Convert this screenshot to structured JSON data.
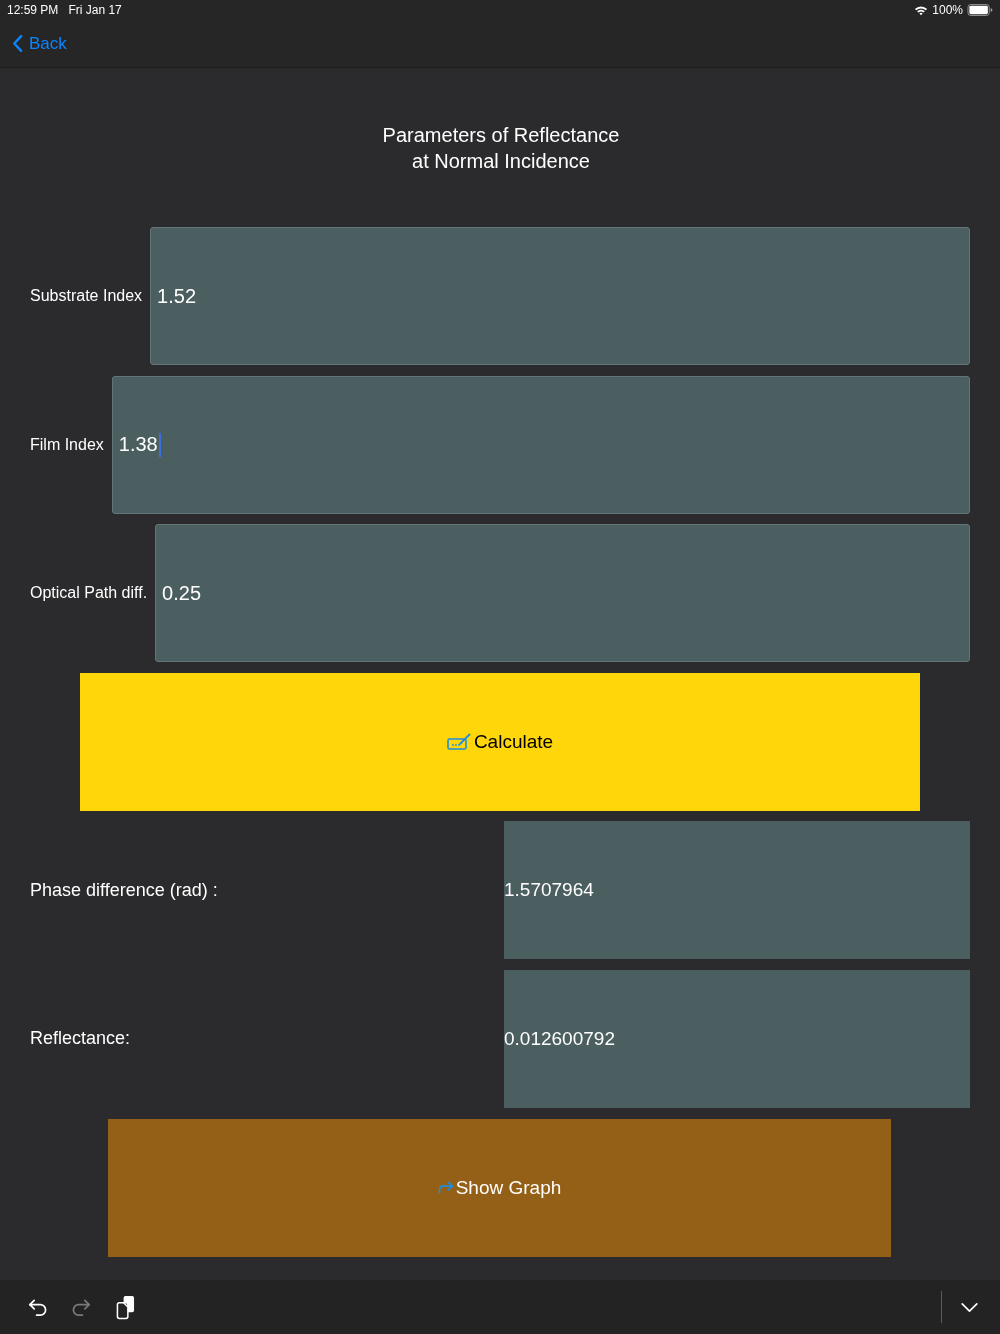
{
  "status_bar": {
    "time": "12:59 PM",
    "date": "Fri Jan 17",
    "battery": "100%"
  },
  "nav": {
    "back": "Back"
  },
  "title": "Parameters of Reflectance\nat Normal Incidence",
  "inputs": [
    {
      "label": "Substrate Index",
      "value": "1.52",
      "focused": false
    },
    {
      "label": "Film Index",
      "value": "1.38",
      "focused": true
    },
    {
      "label": "Optical Path diff.",
      "value": "0.25",
      "focused": false
    }
  ],
  "calculate_button": {
    "label": "Calculate"
  },
  "results": [
    {
      "label": "Phase difference (rad) :",
      "value": "1.5707964"
    },
    {
      "label": "Reflectance:",
      "value": "0.012600792"
    }
  ],
  "graph_button": {
    "label": "Show Graph"
  },
  "keyboard_bar": {
    "items": [
      {
        "kind": "undo",
        "disabled": false
      },
      {
        "kind": "redo",
        "disabled": true
      },
      {
        "kind": "paste",
        "disabled": false
      }
    ]
  }
}
